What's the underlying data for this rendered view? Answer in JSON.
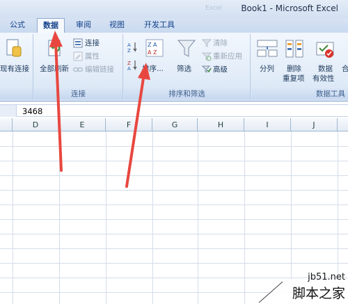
{
  "window": {
    "title": "Book1 - Microsoft Excel",
    "title_faded": "Excel"
  },
  "tabs": [
    {
      "label": "公式",
      "active": false
    },
    {
      "label": "数据",
      "active": true
    },
    {
      "label": "审阅",
      "active": false
    },
    {
      "label": "视图",
      "active": false
    },
    {
      "label": "开发工具",
      "active": false
    }
  ],
  "ribbon": {
    "existing_connections_label": "现有连接",
    "connections_group": {
      "label": "连接",
      "refresh_all_label": "全部刷新",
      "connections_label": "连接",
      "properties_label": "属性",
      "edit_links_label": "编辑链接"
    },
    "sort_filter_group": {
      "label": "排序和筛选",
      "sort_label": "排序...",
      "filter_label": "筛选",
      "clear_label": "清除",
      "reapply_label": "重新应用",
      "advanced_label": "高级"
    },
    "data_tools_group": {
      "label": "数据工具",
      "text_to_columns_label": "分列",
      "remove_dup_line1": "删除",
      "remove_dup_line2": "重复项",
      "validation_line1": "数据",
      "validation_line2": "有效性",
      "consolidate_label": "合"
    }
  },
  "formula_bar": {
    "value": "3468"
  },
  "columns": [
    "D",
    "E",
    "F",
    "G",
    "H",
    "I",
    "J"
  ],
  "watermark": {
    "url": "jb51.net",
    "name": "脚本之家"
  },
  "colors": {
    "annotation_arrow": "#e8473f",
    "ribbon_text": "#1e395b",
    "tab_text": "#15428b"
  },
  "icons": [
    "existing-connections-icon",
    "refresh-all-icon",
    "connections-icon",
    "properties-icon",
    "edit-links-icon",
    "sort-az-icon",
    "sort-za-icon",
    "sort-dialog-icon",
    "filter-icon",
    "clear-filter-icon",
    "reapply-icon",
    "advanced-filter-icon",
    "text-to-columns-icon",
    "remove-duplicates-icon",
    "data-validation-icon"
  ]
}
